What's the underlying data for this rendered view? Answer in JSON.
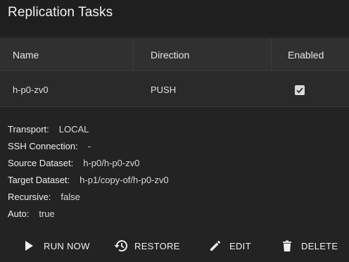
{
  "header": {
    "title": "Replication Tasks"
  },
  "table": {
    "columns": [
      "Name",
      "Direction",
      "Enabled"
    ],
    "rows": [
      {
        "name": "h-p0-zv0",
        "direction": "PUSH",
        "enabled": true
      }
    ]
  },
  "details": {
    "transport": {
      "label": "Transport:",
      "value": "LOCAL"
    },
    "ssh_connection": {
      "label": "SSH Connection:",
      "value": "-"
    },
    "source_dataset": {
      "label": "Source Dataset:",
      "value": "h-p0/h-p0-zv0"
    },
    "target_dataset": {
      "label": "Target Dataset:",
      "value": "h-p1/copy-of/h-p0-zv0"
    },
    "recursive": {
      "label": "Recursive:",
      "value": "false"
    },
    "auto": {
      "label": "Auto:",
      "value": "true"
    }
  },
  "actions": {
    "run_now": {
      "label": "RUN NOW",
      "icon": "play-icon"
    },
    "restore": {
      "label": "RESTORE",
      "icon": "history-icon"
    },
    "edit": {
      "label": "EDIT",
      "icon": "pencil-icon"
    },
    "delete": {
      "label": "DELETE",
      "icon": "trash-icon"
    }
  },
  "colors": {
    "background": "#232323",
    "header_bg": "#303030",
    "row_bg": "#2a2a2a",
    "text": "#e6e6e6"
  }
}
